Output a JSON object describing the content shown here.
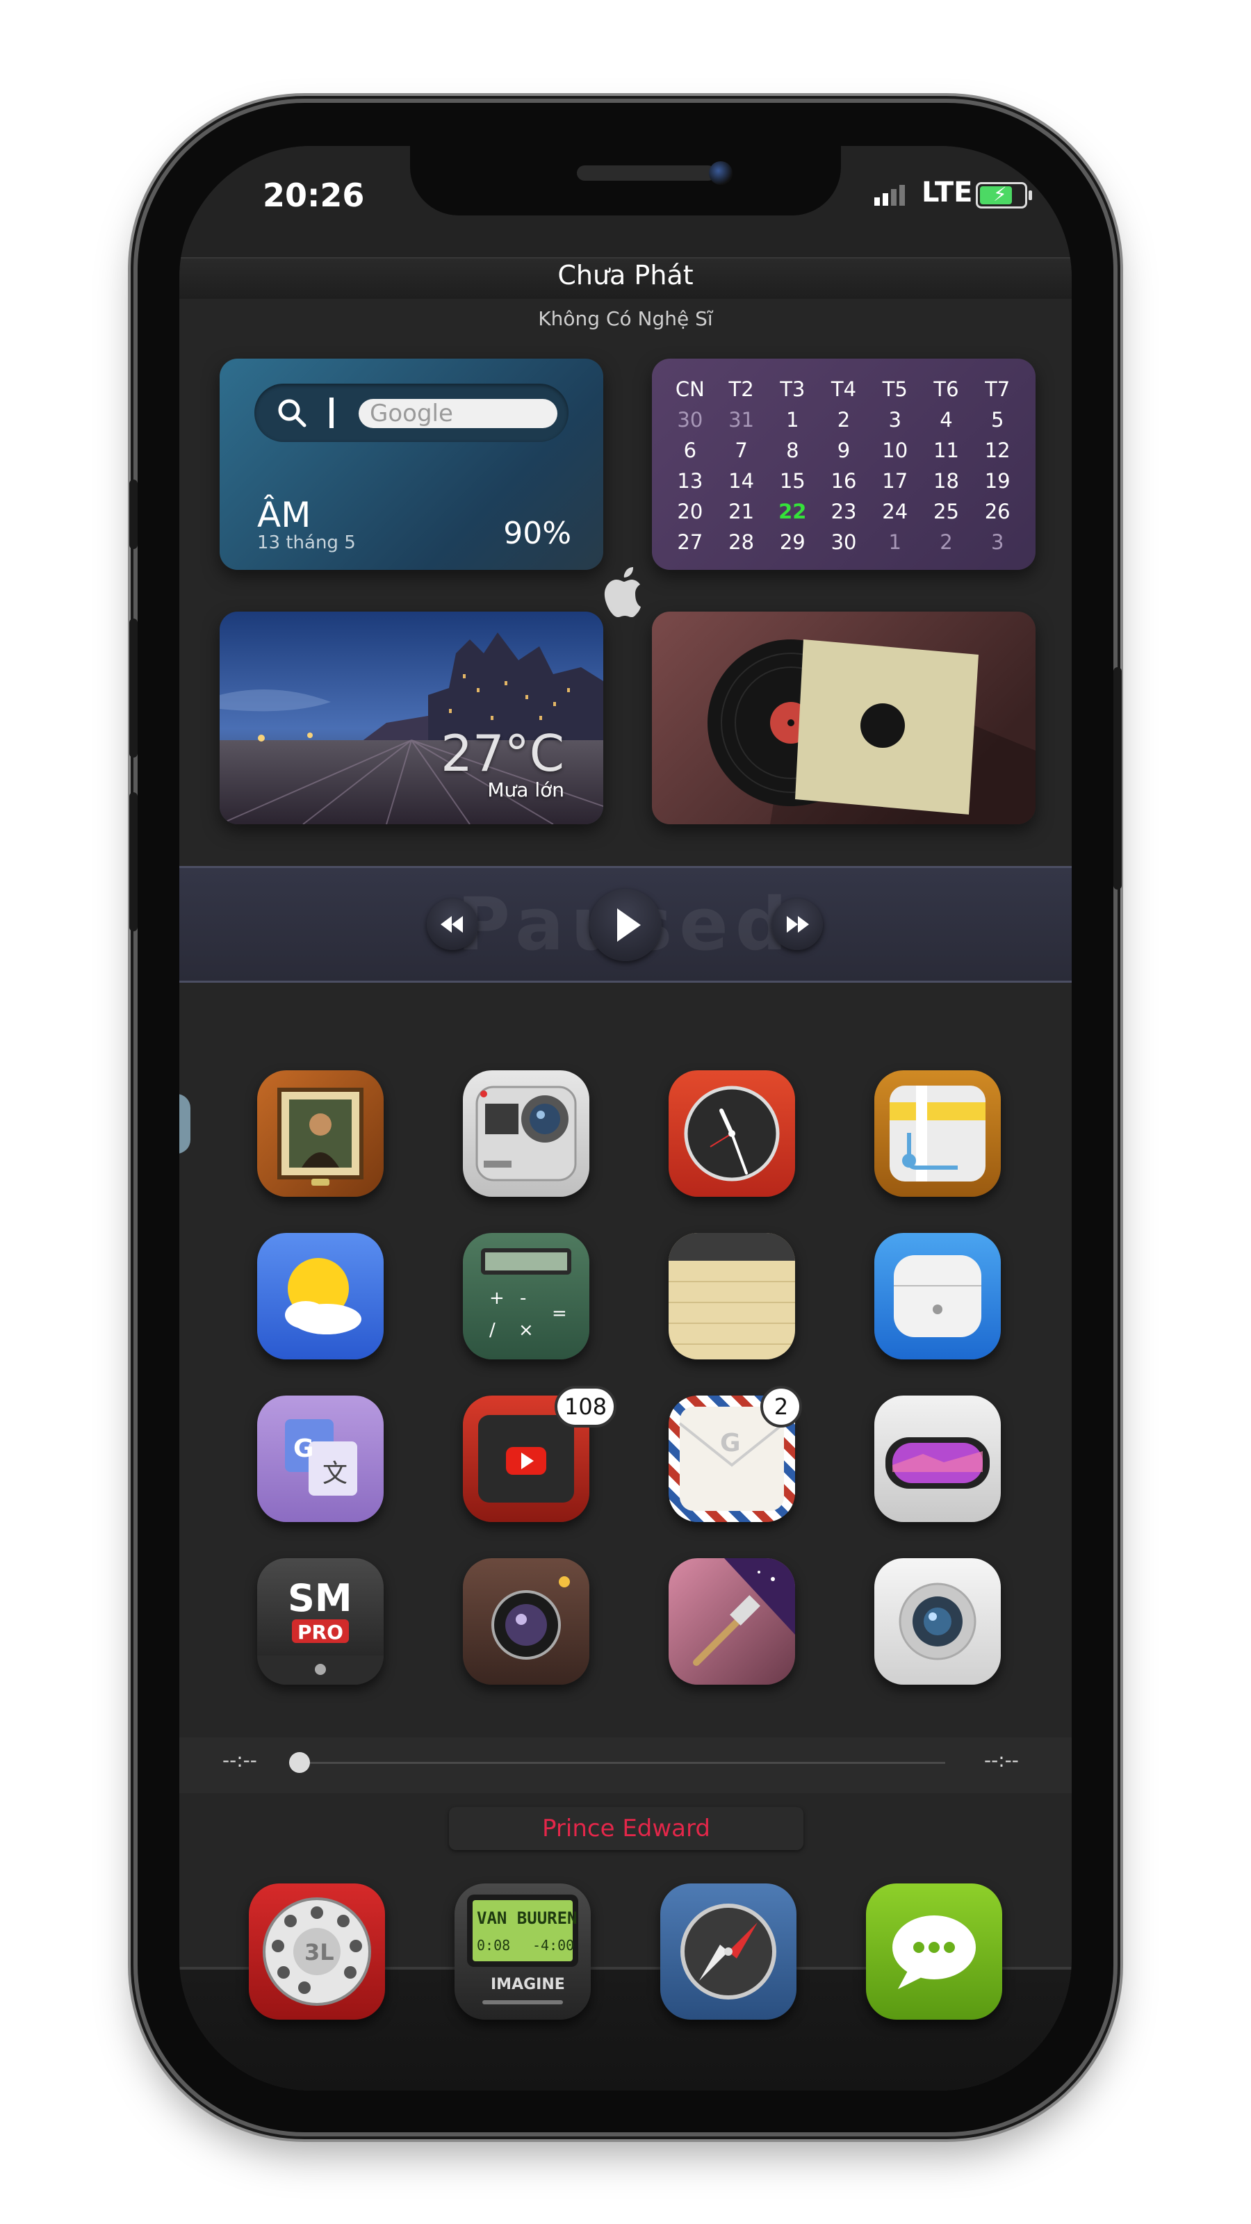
{
  "status_bar": {
    "time": "20:26",
    "network": "LTE"
  },
  "now_playing": {
    "title": "Chưa Phát",
    "artist": "Không Có Nghệ Sĩ",
    "state_text": "Paused"
  },
  "search": {
    "placeholder": "Google"
  },
  "weather": {
    "condition": "ÂM",
    "date": "13 tháng 5",
    "humidity": "90%",
    "temperature": "27°C",
    "description": "Mưa lớn"
  },
  "calendar": {
    "headers": [
      "CN",
      "T2",
      "T3",
      "T4",
      "T5",
      "T6",
      "T7"
    ],
    "weeks": [
      [
        "30",
        "31",
        "1",
        "2",
        "3",
        "4",
        "5"
      ],
      [
        "6",
        "7",
        "8",
        "9",
        "10",
        "11",
        "12"
      ],
      [
        "13",
        "14",
        "15",
        "16",
        "17",
        "18",
        "19"
      ],
      [
        "20",
        "21",
        "22",
        "23",
        "24",
        "25",
        "26"
      ],
      [
        "27",
        "28",
        "29",
        "30",
        "1",
        "2",
        "3"
      ]
    ],
    "today": "22"
  },
  "apps": [
    {
      "name": "photos-app-icon",
      "icon": "mona-lisa-frame"
    },
    {
      "name": "gopro-app-icon",
      "icon": "gopro-camera"
    },
    {
      "name": "clock-app-icon",
      "icon": "clock"
    },
    {
      "name": "maps-app-icon",
      "icon": "map"
    },
    {
      "name": "weather-app-icon",
      "icon": "sun-cloud"
    },
    {
      "name": "calculator-app-icon",
      "icon": "calculator"
    },
    {
      "name": "notes-app-icon",
      "icon": "notepad"
    },
    {
      "name": "airpods-app-icon",
      "icon": "airpods-case"
    },
    {
      "name": "google-translate-app-icon",
      "icon": "translate"
    },
    {
      "name": "youtube-app-icon",
      "icon": "youtube",
      "badge": "108"
    },
    {
      "name": "gmail-app-icon",
      "icon": "envelope",
      "badge": "2"
    },
    {
      "name": "goggles-app-icon",
      "icon": "ski-goggles"
    },
    {
      "name": "smpro-app-icon",
      "icon": "smpro",
      "label": "SM",
      "sublabel": "PRO"
    },
    {
      "name": "camera-app-icon",
      "icon": "leather-camera"
    },
    {
      "name": "wallpaper-app-icon",
      "icon": "scraper-palm"
    },
    {
      "name": "facetime-app-icon",
      "icon": "webcam"
    }
  ],
  "seek": {
    "elapsed": "--:--",
    "remaining": "--:--",
    "progress": 0
  },
  "location": "Prince Edward",
  "dock": [
    {
      "name": "phone-app-icon",
      "icon": "rotary-dial",
      "label": "3L"
    },
    {
      "name": "music-app-icon",
      "icon": "lcd-player",
      "line1": "VAN BUUREN",
      "line2a": "0:08",
      "line2b": "-4:00",
      "brand": "IMAGINE"
    },
    {
      "name": "safari-app-icon",
      "icon": "compass"
    },
    {
      "name": "messages-app-icon",
      "icon": "chat-bubble"
    }
  ],
  "colors": {
    "accent_location": "#e3274a",
    "today": "#35e23a"
  }
}
